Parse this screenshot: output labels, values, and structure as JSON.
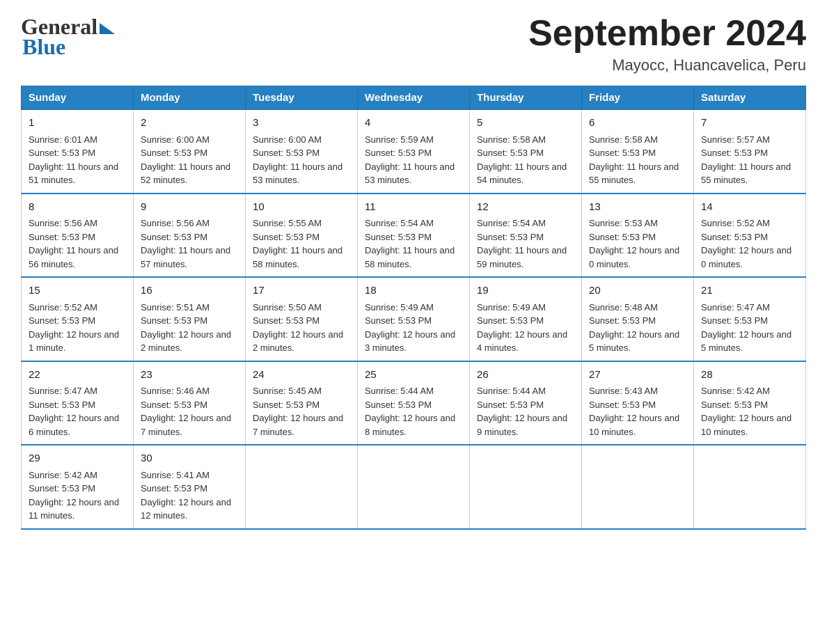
{
  "header": {
    "title": "September 2024",
    "subtitle": "Mayocc, Huancavelica, Peru",
    "logo_line1": "General",
    "logo_line2": "Blue"
  },
  "days_of_week": [
    "Sunday",
    "Monday",
    "Tuesday",
    "Wednesday",
    "Thursday",
    "Friday",
    "Saturday"
  ],
  "weeks": [
    [
      {
        "day": "1",
        "sunrise": "6:01 AM",
        "sunset": "5:53 PM",
        "daylight": "11 hours and 51 minutes."
      },
      {
        "day": "2",
        "sunrise": "6:00 AM",
        "sunset": "5:53 PM",
        "daylight": "11 hours and 52 minutes."
      },
      {
        "day": "3",
        "sunrise": "6:00 AM",
        "sunset": "5:53 PM",
        "daylight": "11 hours and 53 minutes."
      },
      {
        "day": "4",
        "sunrise": "5:59 AM",
        "sunset": "5:53 PM",
        "daylight": "11 hours and 53 minutes."
      },
      {
        "day": "5",
        "sunrise": "5:58 AM",
        "sunset": "5:53 PM",
        "daylight": "11 hours and 54 minutes."
      },
      {
        "day": "6",
        "sunrise": "5:58 AM",
        "sunset": "5:53 PM",
        "daylight": "11 hours and 55 minutes."
      },
      {
        "day": "7",
        "sunrise": "5:57 AM",
        "sunset": "5:53 PM",
        "daylight": "11 hours and 55 minutes."
      }
    ],
    [
      {
        "day": "8",
        "sunrise": "5:56 AM",
        "sunset": "5:53 PM",
        "daylight": "11 hours and 56 minutes."
      },
      {
        "day": "9",
        "sunrise": "5:56 AM",
        "sunset": "5:53 PM",
        "daylight": "11 hours and 57 minutes."
      },
      {
        "day": "10",
        "sunrise": "5:55 AM",
        "sunset": "5:53 PM",
        "daylight": "11 hours and 58 minutes."
      },
      {
        "day": "11",
        "sunrise": "5:54 AM",
        "sunset": "5:53 PM",
        "daylight": "11 hours and 58 minutes."
      },
      {
        "day": "12",
        "sunrise": "5:54 AM",
        "sunset": "5:53 PM",
        "daylight": "11 hours and 59 minutes."
      },
      {
        "day": "13",
        "sunrise": "5:53 AM",
        "sunset": "5:53 PM",
        "daylight": "12 hours and 0 minutes."
      },
      {
        "day": "14",
        "sunrise": "5:52 AM",
        "sunset": "5:53 PM",
        "daylight": "12 hours and 0 minutes."
      }
    ],
    [
      {
        "day": "15",
        "sunrise": "5:52 AM",
        "sunset": "5:53 PM",
        "daylight": "12 hours and 1 minute."
      },
      {
        "day": "16",
        "sunrise": "5:51 AM",
        "sunset": "5:53 PM",
        "daylight": "12 hours and 2 minutes."
      },
      {
        "day": "17",
        "sunrise": "5:50 AM",
        "sunset": "5:53 PM",
        "daylight": "12 hours and 2 minutes."
      },
      {
        "day": "18",
        "sunrise": "5:49 AM",
        "sunset": "5:53 PM",
        "daylight": "12 hours and 3 minutes."
      },
      {
        "day": "19",
        "sunrise": "5:49 AM",
        "sunset": "5:53 PM",
        "daylight": "12 hours and 4 minutes."
      },
      {
        "day": "20",
        "sunrise": "5:48 AM",
        "sunset": "5:53 PM",
        "daylight": "12 hours and 5 minutes."
      },
      {
        "day": "21",
        "sunrise": "5:47 AM",
        "sunset": "5:53 PM",
        "daylight": "12 hours and 5 minutes."
      }
    ],
    [
      {
        "day": "22",
        "sunrise": "5:47 AM",
        "sunset": "5:53 PM",
        "daylight": "12 hours and 6 minutes."
      },
      {
        "day": "23",
        "sunrise": "5:46 AM",
        "sunset": "5:53 PM",
        "daylight": "12 hours and 7 minutes."
      },
      {
        "day": "24",
        "sunrise": "5:45 AM",
        "sunset": "5:53 PM",
        "daylight": "12 hours and 7 minutes."
      },
      {
        "day": "25",
        "sunrise": "5:44 AM",
        "sunset": "5:53 PM",
        "daylight": "12 hours and 8 minutes."
      },
      {
        "day": "26",
        "sunrise": "5:44 AM",
        "sunset": "5:53 PM",
        "daylight": "12 hours and 9 minutes."
      },
      {
        "day": "27",
        "sunrise": "5:43 AM",
        "sunset": "5:53 PM",
        "daylight": "12 hours and 10 minutes."
      },
      {
        "day": "28",
        "sunrise": "5:42 AM",
        "sunset": "5:53 PM",
        "daylight": "12 hours and 10 minutes."
      }
    ],
    [
      {
        "day": "29",
        "sunrise": "5:42 AM",
        "sunset": "5:53 PM",
        "daylight": "12 hours and 11 minutes."
      },
      {
        "day": "30",
        "sunrise": "5:41 AM",
        "sunset": "5:53 PM",
        "daylight": "12 hours and 12 minutes."
      },
      null,
      null,
      null,
      null,
      null
    ]
  ]
}
